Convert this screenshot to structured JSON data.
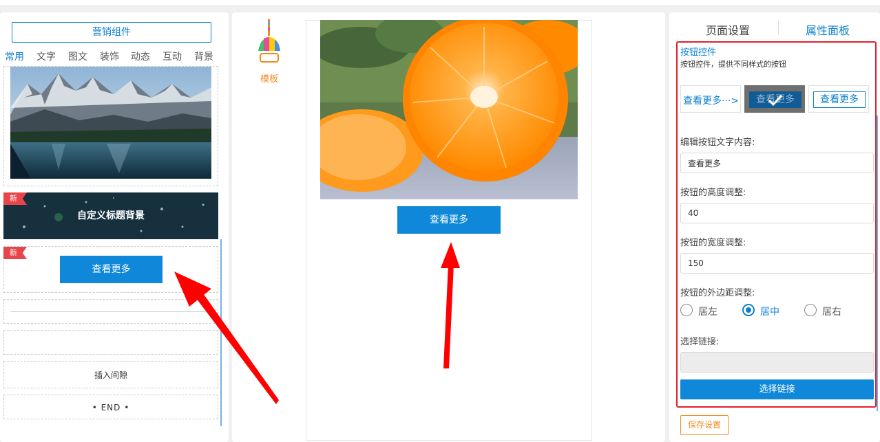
{
  "left_panel": {
    "marketing_button": "营销组件",
    "tabs": [
      "常用",
      "文字",
      "图文",
      "装饰",
      "动态",
      "互动",
      "背景"
    ],
    "active_tab": "常用",
    "banner_text": "自定义标题背景",
    "new_tag": "新",
    "sample_button": "查看更多",
    "gap_text": "插入间隙",
    "end_text": "•    END    •"
  },
  "center": {
    "template_label": "模板",
    "preview_button": "查看更多"
  },
  "right_panel": {
    "tabs": [
      "页面设置",
      "属性面板"
    ],
    "active_tab": "属性面板",
    "title": "按钮控件",
    "description": "按钮控件，提供不同样式的按钮",
    "styles": [
      "查看更多···>",
      "查看更多",
      "查看更多"
    ],
    "selected_style": 2,
    "text_label": "编辑按钮文字内容:",
    "text_value": "查看更多",
    "height_label": "按钮的高度调整:",
    "height_value": "40",
    "width_label": "按钮的宽度调整:",
    "width_value": "150",
    "margin_label": "按钮的外边距调整:",
    "align_options": [
      "居左",
      "居中",
      "居右"
    ],
    "align_selected": "居中",
    "link_label": "选择链接:",
    "link_value": "",
    "select_link_button": "选择链接",
    "save_button": "保存设置"
  },
  "colors": {
    "accent": "#0f88d9",
    "highlight_border": "#e0202a",
    "save_orange": "#f28a1c",
    "new_tag": "#e8454b"
  }
}
